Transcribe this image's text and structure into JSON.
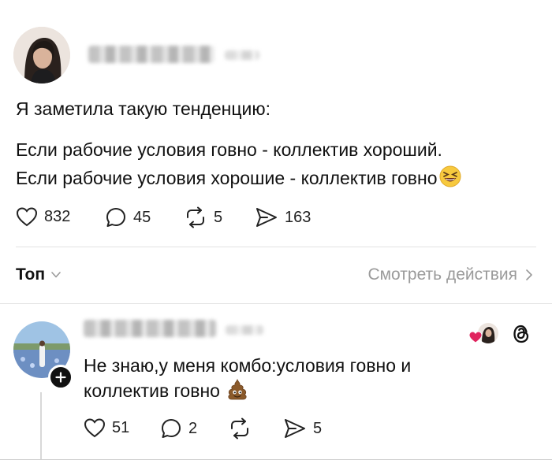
{
  "post": {
    "intro": "Я заметила такую тенденцию:",
    "line1": "Если рабочие условия говно - коллектив хороший.",
    "line2": "Если рабочие условия хорошие - коллектив говно",
    "emoji_icon": "grinning-squinting-face-icon",
    "stats": {
      "likes": "832",
      "comments": "45",
      "reposts": "5",
      "shares": "163"
    }
  },
  "controls": {
    "sort_label": "Топ",
    "activity_link": "Смотреть действия"
  },
  "reply": {
    "line1": "Не знаю,у меня комбо:условия говно и",
    "line2": "коллектив говно",
    "emoji_icon": "pile-of-poo-icon",
    "stats": {
      "likes": "51",
      "comments": "2",
      "reposts": "",
      "shares": "5"
    }
  },
  "colors": {
    "text": "#111111",
    "muted": "#9a9a9a",
    "heart": "#e0245e",
    "divider": "#e3e3e3"
  }
}
